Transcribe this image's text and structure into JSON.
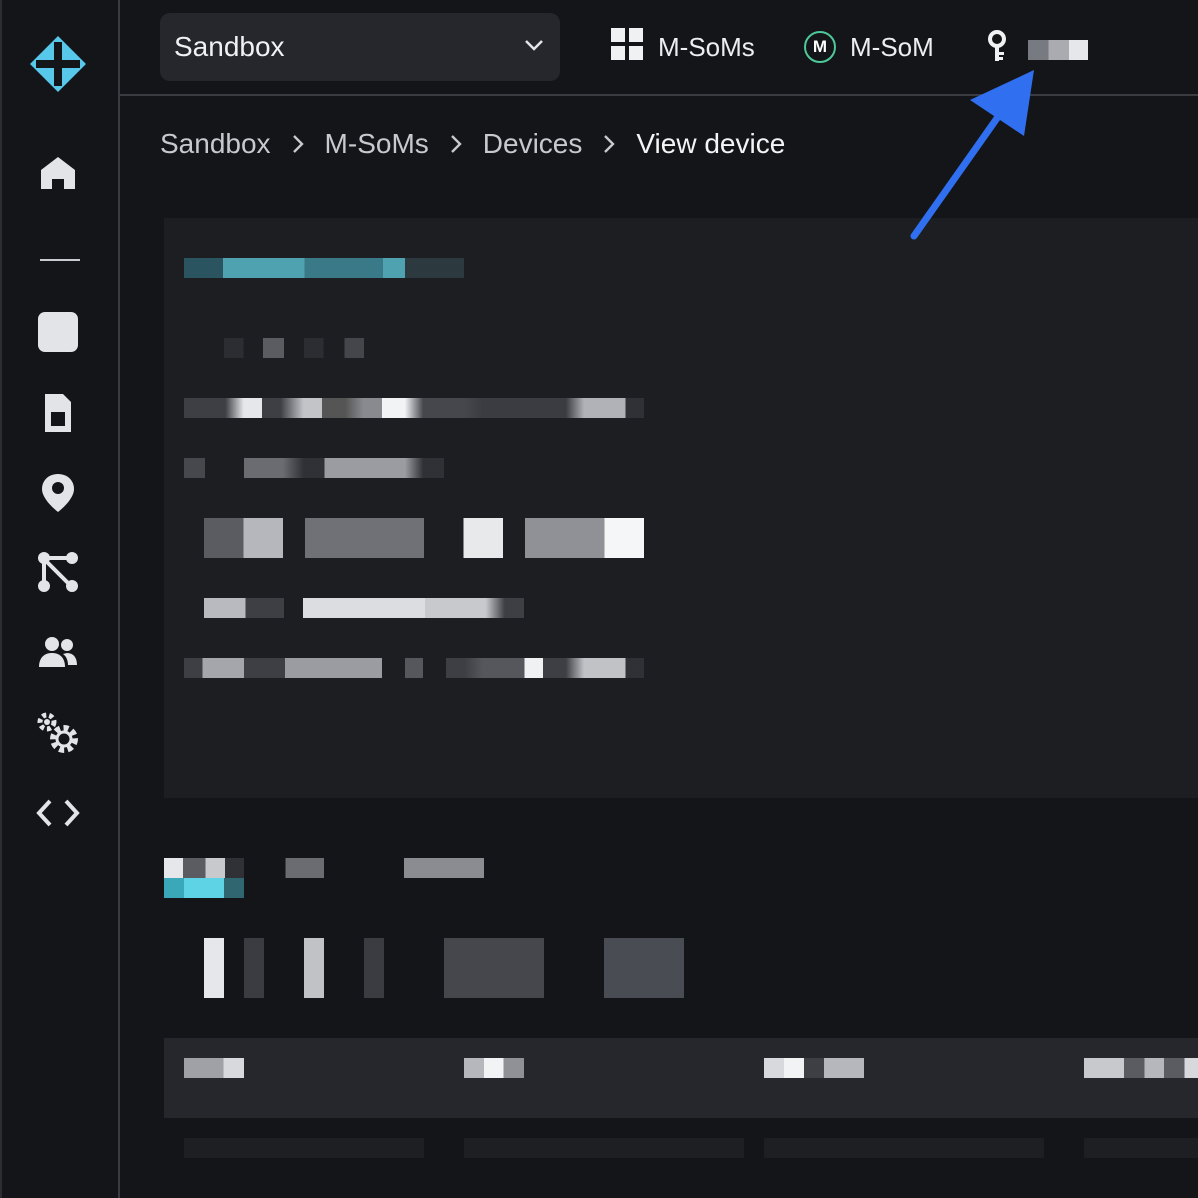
{
  "sidebar": {
    "logo_icon": "diamond-plus-logo",
    "items": [
      {
        "icon": "home-icon"
      },
      {
        "icon": "square-icon"
      },
      {
        "icon": "sim-card-icon"
      },
      {
        "icon": "location-pin-icon"
      },
      {
        "icon": "integrations-icon"
      },
      {
        "icon": "team-icon"
      },
      {
        "icon": "settings-gears-icon"
      },
      {
        "icon": "code-icon"
      }
    ]
  },
  "topbar": {
    "org_select": {
      "value": "Sandbox",
      "icon": "chevron-down-icon"
    },
    "product_link": {
      "label": "M-SoMs",
      "icon": "grid-icon"
    },
    "platform_link": {
      "label": "M-SoM",
      "badge": "M"
    },
    "key_icon": "key-icon"
  },
  "breadcrumb": {
    "items": [
      "Sandbox",
      "M-SoMs",
      "Devices"
    ],
    "current": "View device"
  },
  "colors": {
    "accent": "#4fc3d8",
    "arrow": "#2f6ff0",
    "badge_green": "#4ec99a",
    "background": "#141518",
    "panel": "#1c1e22"
  }
}
